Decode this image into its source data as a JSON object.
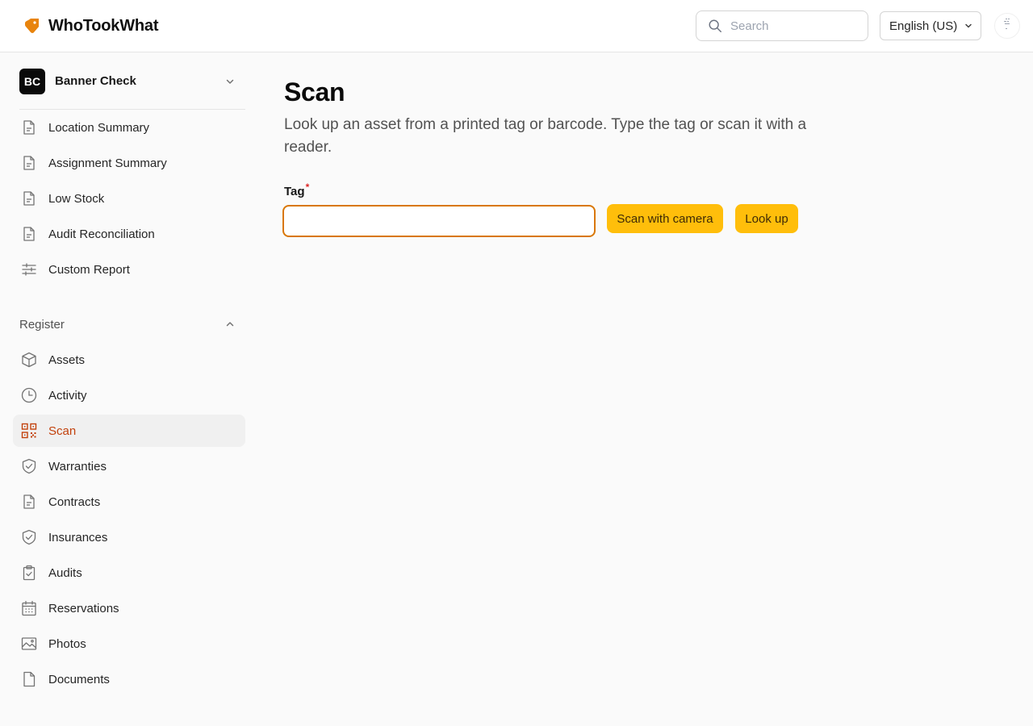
{
  "header": {
    "brand_name": "WhoTookWhat",
    "search_placeholder": "Search",
    "language": "English (US)"
  },
  "colors": {
    "accent": "#ffbe0b",
    "brand_orange": "#e8840e",
    "active_text": "#c2410c",
    "required": "#dc2626"
  },
  "sidebar": {
    "org": {
      "initials": "BC",
      "name": "Banner Check"
    },
    "reports": [
      {
        "label": "Location Summary",
        "icon": "file-text-icon"
      },
      {
        "label": "Assignment Summary",
        "icon": "file-text-icon"
      },
      {
        "label": "Low Stock",
        "icon": "file-text-icon"
      },
      {
        "label": "Audit Reconciliation",
        "icon": "file-text-icon"
      },
      {
        "label": "Custom Report",
        "icon": "sliders-icon"
      }
    ],
    "section_title": "Register",
    "items": [
      {
        "label": "Assets",
        "icon": "box-icon"
      },
      {
        "label": "Activity",
        "icon": "clock-icon"
      },
      {
        "label": "Scan",
        "icon": "qr-code-icon",
        "active": true
      },
      {
        "label": "Warranties",
        "icon": "shield-check-icon"
      },
      {
        "label": "Contracts",
        "icon": "file-text-icon"
      },
      {
        "label": "Insurances",
        "icon": "shield-check-icon"
      },
      {
        "label": "Audits",
        "icon": "clipboard-check-icon"
      },
      {
        "label": "Reservations",
        "icon": "calendar-icon"
      },
      {
        "label": "Photos",
        "icon": "image-icon"
      },
      {
        "label": "Documents",
        "icon": "file-icon"
      }
    ]
  },
  "main": {
    "title": "Scan",
    "description": "Look up an asset from a printed tag or barcode. Type the tag or scan it with a reader.",
    "field_label": "Tag",
    "required_mark": "*",
    "tag_value": "",
    "scan_button": "Scan with camera",
    "lookup_button": "Look up"
  }
}
